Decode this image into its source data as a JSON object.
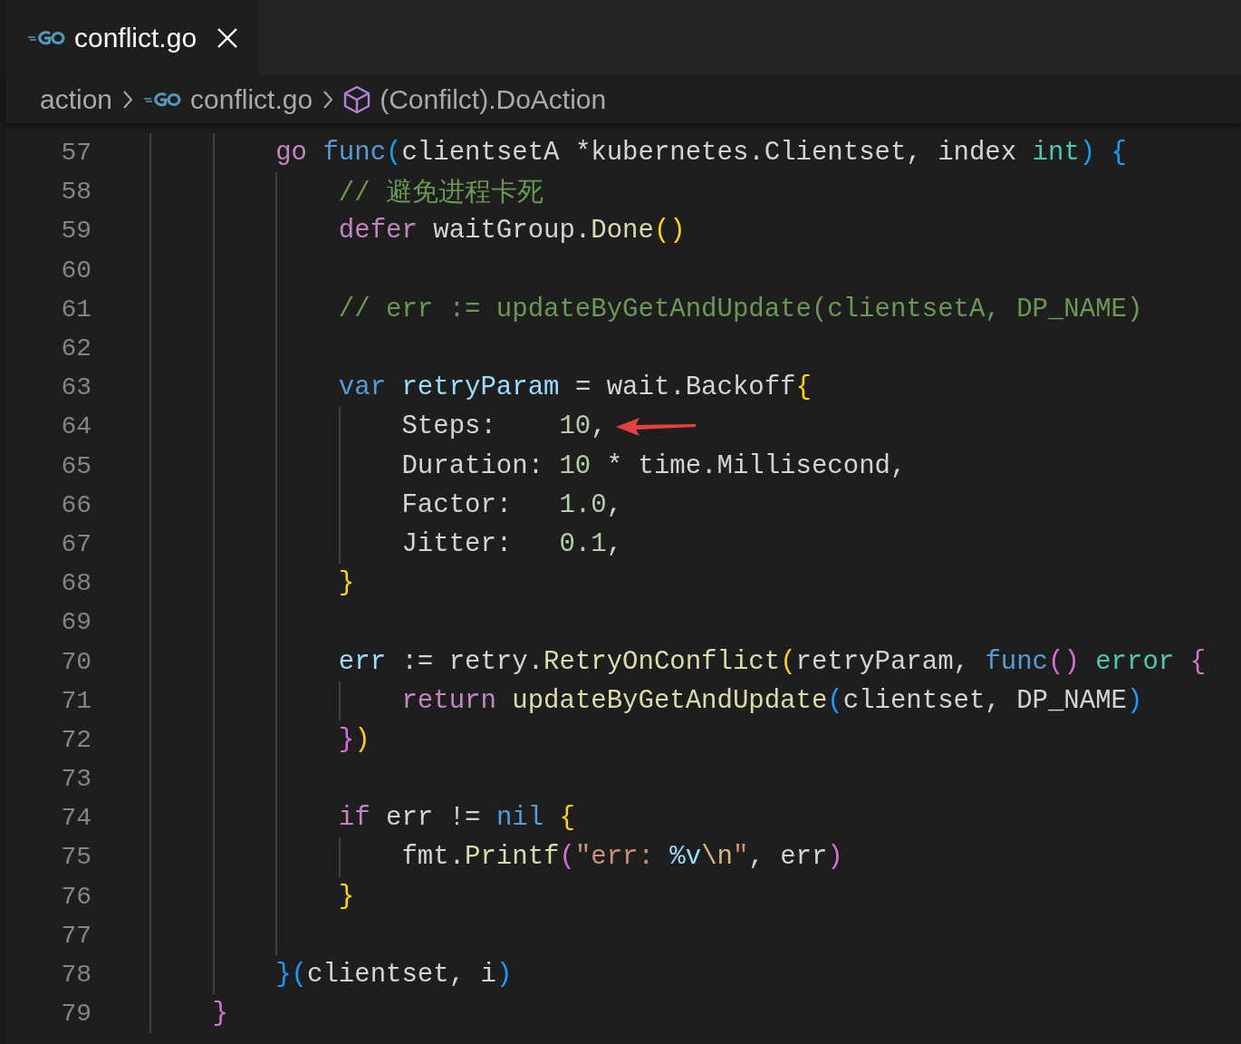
{
  "tabs": [
    {
      "label": "conflict.go",
      "selected": true
    }
  ],
  "breadcrumbs": [
    {
      "kind": "folder",
      "label": "action"
    },
    {
      "kind": "file",
      "label": "conflict.go"
    },
    {
      "kind": "method",
      "label": "(Confilct).DoAction"
    }
  ],
  "block": {
    "lines": [
      {
        "number": "57",
        "tokens": [
          {
            "kind": "keyword",
            "text": "go "
          },
          {
            "kind": "storage",
            "text": "func"
          },
          {
            "kind": "bracket3",
            "text": "("
          },
          {
            "kind": "plain",
            "text": "clientsetA *kubernetes.Clientset, index "
          },
          {
            "kind": "type",
            "text": "int"
          },
          {
            "kind": "bracket3",
            "text": ") {"
          }
        ],
        "children": [
          {
            "number": "58",
            "tokens": [
              {
                "kind": "comment",
                "text": "// 避免进程卡死"
              }
            ]
          },
          {
            "number": "59",
            "tokens": [
              {
                "kind": "keyword",
                "text": "defer"
              },
              {
                "kind": "plain",
                "text": " waitGroup."
              },
              {
                "kind": "function",
                "text": "Done"
              },
              {
                "kind": "bracket1",
                "text": "()"
              }
            ]
          },
          {
            "number": "60"
          },
          {
            "number": "61",
            "tokens": [
              {
                "kind": "comment",
                "text": "// err := updateByGetAndUpdate(clientsetA, DP_NAME)"
              }
            ]
          },
          {
            "number": "62"
          },
          {
            "number": "63",
            "tokens": [
              {
                "kind": "storage",
                "text": "var "
              },
              {
                "kind": "variable",
                "text": "retryParam"
              },
              {
                "kind": "plain",
                "text": " = wait.Backoff"
              },
              {
                "kind": "bracket1",
                "text": "{"
              }
            ],
            "children": [
              {
                "number": "64",
                "arrow": true,
                "tokens": [
                  {
                    "kind": "plain",
                    "text": "Steps:    "
                  },
                  {
                    "kind": "number",
                    "text": "10"
                  },
                  {
                    "kind": "plain",
                    "text": ","
                  }
                ]
              },
              {
                "number": "65",
                "tokens": [
                  {
                    "kind": "plain",
                    "text": "Duration: "
                  },
                  {
                    "kind": "number",
                    "text": "10"
                  },
                  {
                    "kind": "plain",
                    "text": " * time.Millisecond,"
                  }
                ]
              },
              {
                "number": "66",
                "tokens": [
                  {
                    "kind": "plain",
                    "text": "Factor:   "
                  },
                  {
                    "kind": "number",
                    "text": "1.0"
                  },
                  {
                    "kind": "plain",
                    "text": ","
                  }
                ]
              },
              {
                "number": "67",
                "tokens": [
                  {
                    "kind": "plain",
                    "text": "Jitter:   "
                  },
                  {
                    "kind": "number",
                    "text": "0.1"
                  },
                  {
                    "kind": "plain",
                    "text": ","
                  }
                ]
              }
            ]
          },
          {
            "number": "68",
            "tokens": [
              {
                "kind": "bracket1",
                "text": "}"
              }
            ]
          },
          {
            "number": "69"
          },
          {
            "number": "70",
            "tokens": [
              {
                "kind": "variable",
                "text": "err"
              },
              {
                "kind": "plain",
                "text": " := retry."
              },
              {
                "kind": "function",
                "text": "RetryOnConflict"
              },
              {
                "kind": "bracket1",
                "text": "("
              },
              {
                "kind": "plain",
                "text": "retryParam, "
              },
              {
                "kind": "storage",
                "text": "func"
              },
              {
                "kind": "bracket2",
                "text": "() "
              },
              {
                "kind": "type",
                "text": "error "
              },
              {
                "kind": "bracket2",
                "text": "{"
              }
            ],
            "children": [
              {
                "number": "71",
                "tokens": [
                  {
                    "kind": "keyword",
                    "text": "return "
                  },
                  {
                    "kind": "function",
                    "text": "updateByGetAndUpdate"
                  },
                  {
                    "kind": "bracket3",
                    "text": "("
                  },
                  {
                    "kind": "plain",
                    "text": "clientset, DP_NAME"
                  },
                  {
                    "kind": "bracket3",
                    "text": ")"
                  }
                ]
              }
            ]
          },
          {
            "number": "72",
            "tokens": [
              {
                "kind": "bracket2",
                "text": "}"
              },
              {
                "kind": "bracket1",
                "text": ")"
              }
            ]
          },
          {
            "number": "73"
          },
          {
            "number": "74",
            "tokens": [
              {
                "kind": "keyword",
                "text": "if"
              },
              {
                "kind": "plain",
                "text": " err != "
              },
              {
                "kind": "storage",
                "text": "nil "
              },
              {
                "kind": "bracket1",
                "text": "{"
              }
            ],
            "children": [
              {
                "number": "75",
                "tokens": [
                  {
                    "kind": "plain",
                    "text": "fmt."
                  },
                  {
                    "kind": "function",
                    "text": "Printf"
                  },
                  {
                    "kind": "bracket2",
                    "text": "("
                  },
                  {
                    "kind": "string",
                    "text": "\"err: "
                  },
                  {
                    "kind": "variable",
                    "text": "%v"
                  },
                  {
                    "kind": "escape",
                    "text": "\\n"
                  },
                  {
                    "kind": "string",
                    "text": "\""
                  },
                  {
                    "kind": "plain",
                    "text": ", err"
                  },
                  {
                    "kind": "bracket2",
                    "text": ")"
                  }
                ]
              }
            ]
          },
          {
            "number": "76",
            "tokens": [
              {
                "kind": "bracket1",
                "text": "}"
              }
            ]
          },
          {
            "number": "77"
          }
        ]
      },
      {
        "number": "78",
        "tokens": [
          {
            "kind": "bracket3",
            "text": "}("
          },
          {
            "kind": "plain",
            "text": "clientset, i"
          },
          {
            "kind": "bracket3",
            "text": ")"
          }
        ]
      }
    ]
  },
  "closing_line": {
    "number": "79",
    "tokens": [
      {
        "kind": "bracket2",
        "text": "}"
      }
    ]
  }
}
